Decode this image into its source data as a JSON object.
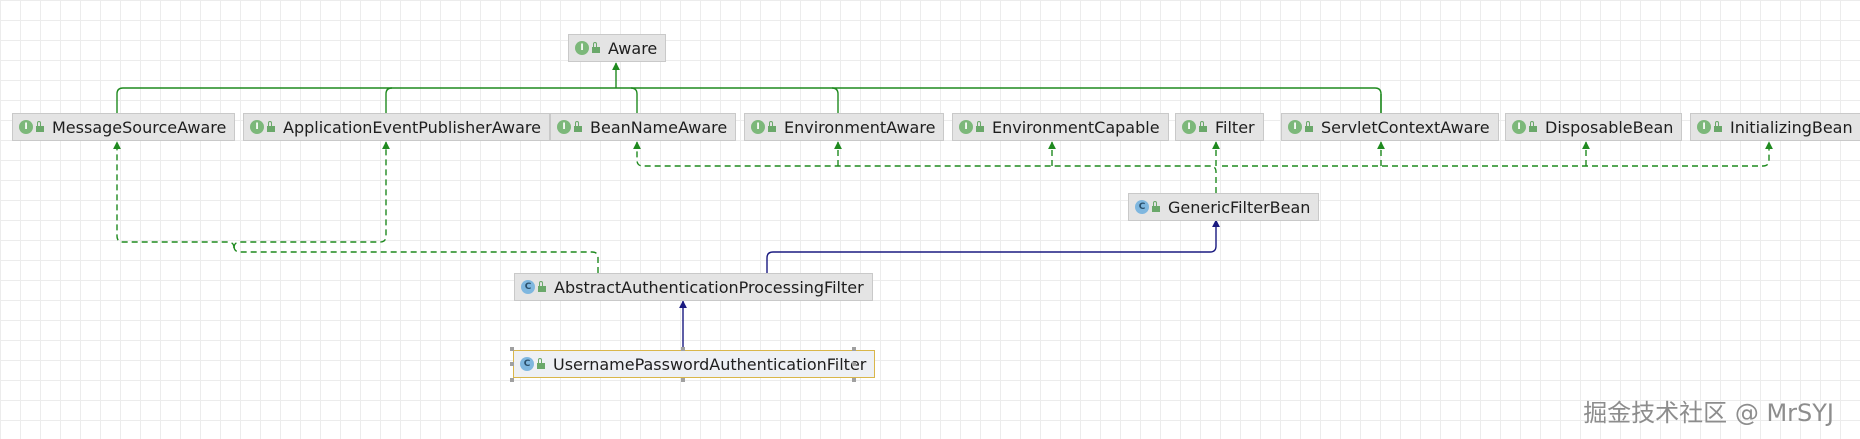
{
  "nodes": {
    "aware": {
      "label": "Aware",
      "kind": "I"
    },
    "message_source_aware": {
      "label": "MessageSourceAware",
      "kind": "I"
    },
    "application_event_publisher_aware": {
      "label": "ApplicationEventPublisherAware",
      "kind": "I"
    },
    "bean_name_aware": {
      "label": "BeanNameAware",
      "kind": "I"
    },
    "environment_aware": {
      "label": "EnvironmentAware",
      "kind": "I"
    },
    "environment_capable": {
      "label": "EnvironmentCapable",
      "kind": "I"
    },
    "filter": {
      "label": "Filter",
      "kind": "I"
    },
    "servlet_context_aware": {
      "label": "ServletContextAware",
      "kind": "I"
    },
    "disposable_bean": {
      "label": "DisposableBean",
      "kind": "I"
    },
    "initializing_bean": {
      "label": "InitializingBean",
      "kind": "I"
    },
    "generic_filter_bean": {
      "label": "GenericFilterBean",
      "kind": "C"
    },
    "abstract_authentication_processing_filter": {
      "label": "AbstractAuthenticationProcessingFilter",
      "kind": "C"
    },
    "username_password_authentication_filter": {
      "label": "UsernamePasswordAuthenticationFilter",
      "kind": "C"
    }
  },
  "colors": {
    "interface_extends": "#1f8a1f",
    "class_extends": "#1a1a80",
    "selected_border": "#d9b64a"
  },
  "watermark": "掘金技术社区 @ MrSYJ"
}
